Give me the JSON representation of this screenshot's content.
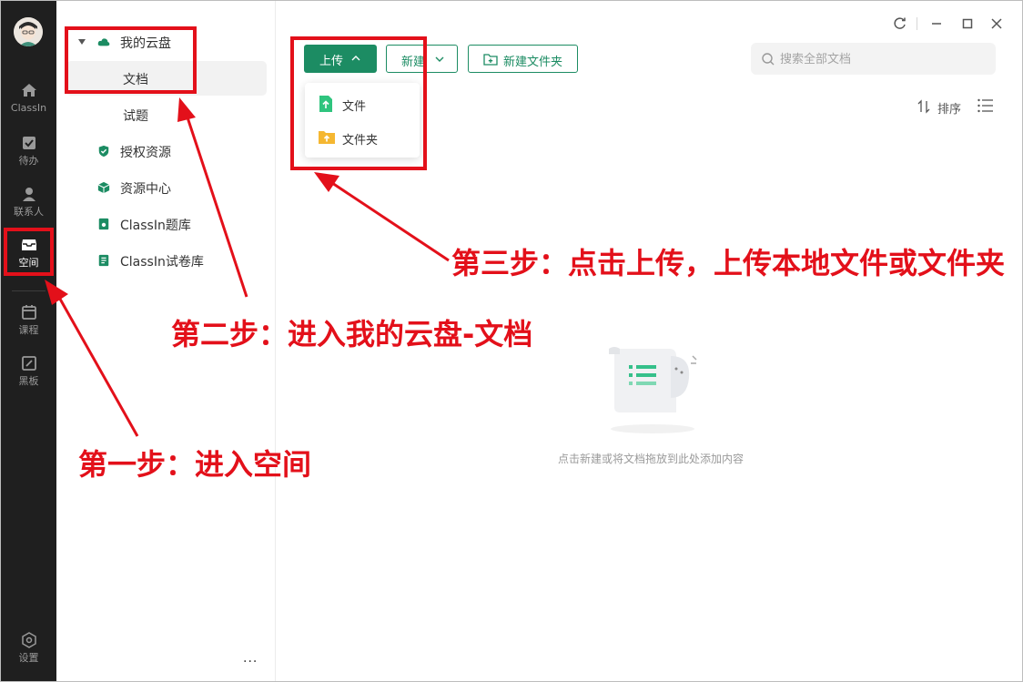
{
  "rail": {
    "items": [
      {
        "label": "ClassIn",
        "icon": "home-icon"
      },
      {
        "label": "待办",
        "icon": "todo-icon"
      },
      {
        "label": "联系人",
        "icon": "contacts-icon"
      },
      {
        "label": "空间",
        "icon": "space-icon"
      },
      {
        "label": "课程",
        "icon": "calendar-icon"
      },
      {
        "label": "黑板",
        "icon": "blackboard-icon"
      }
    ],
    "settings_label": "设置",
    "active": "空间"
  },
  "nav": {
    "cloud_label": "我的云盘",
    "docs_label": "文档",
    "questions_label": "试题",
    "licensed_label": "授权资源",
    "resource_center_label": "资源中心",
    "question_bank_label": "ClassIn题库",
    "paper_bank_label": "ClassIn试卷库",
    "more_label": "...",
    "selected": "文档"
  },
  "toolbar": {
    "upload_label": "上传",
    "new_label": "新建",
    "new_folder_label": "新建文件夹",
    "sort_label": "排序"
  },
  "search": {
    "placeholder": "搜索全部文档"
  },
  "dropdown": {
    "items": [
      {
        "label": "文件",
        "icon": "file-upload-icon"
      },
      {
        "label": "文件夹",
        "icon": "folder-upload-icon"
      }
    ]
  },
  "empty": {
    "text": "点击新建或将文档拖放到此处添加内容"
  },
  "annotations": {
    "step1": "第一步：进入空间",
    "step2": "第二步：进入我的云盘-文档",
    "step3": "第三步：点击上传，上传本地文件或文件夹"
  },
  "colors": {
    "brand_green": "#1c8c63",
    "annotation_red": "#e3101a",
    "rail_bg": "#1f1f1f"
  }
}
